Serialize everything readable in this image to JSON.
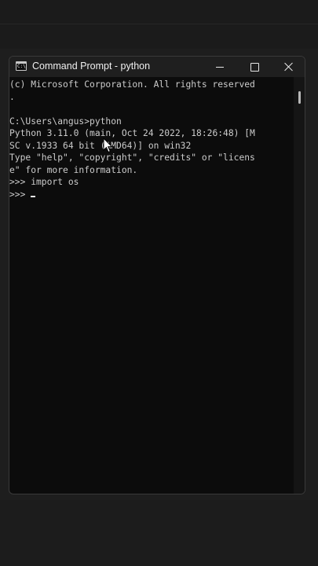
{
  "window": {
    "title": "Command Prompt - python",
    "app_icon_text": "C:\\",
    "controls": {
      "minimize": "minimize",
      "maximize": "maximize",
      "close": "close"
    }
  },
  "console": {
    "lines": [
      "(c) Microsoft Corporation. All rights reserved",
      ".",
      "",
      "C:\\Users\\angus>python",
      "Python 3.11.0 (main, Oct 24 2022, 18:26:48) [M",
      "SC v.1933 64 bit (AMD64)] on win32",
      "Type \"help\", \"copyright\", \"credits\" or \"licens",
      "e\" for more information.",
      ">>> import os",
      ">>> "
    ]
  },
  "colors": {
    "console_bg": "#0c0c0c",
    "console_text": "#cccccc",
    "titlebar_bg": "#1f1f1f"
  },
  "icons": {
    "app": "command-prompt-icon",
    "minimize": "minimize-icon",
    "maximize": "maximize-icon",
    "close": "close-icon",
    "pointer": "mouse-pointer-icon"
  }
}
